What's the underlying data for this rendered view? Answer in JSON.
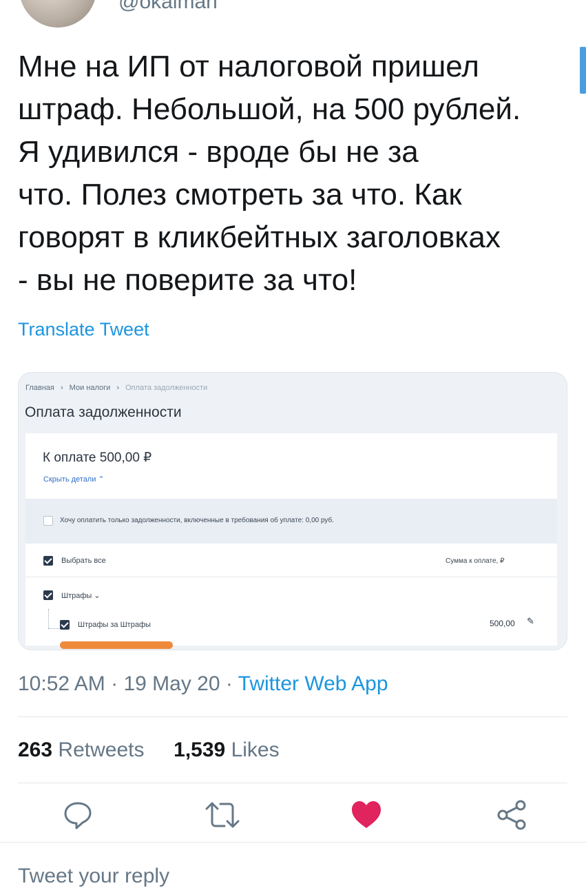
{
  "header": {
    "handle": "@okalman"
  },
  "tweet": {
    "text": "Мне на ИП от налоговой пришел\nштраф. Небольшой, на 500 рублей.\nЯ удивился - вроде бы не за\nчто. Полез смотреть за что. Как\nговорят в кликбейтных заголовках\n- вы не поверите за что!",
    "translate_label": "Translate Tweet"
  },
  "embedded": {
    "breadcrumbs": [
      "Главная",
      "Мои налоги",
      "Оплата задолженности"
    ],
    "title": "Оплата задолженности",
    "amount": "К оплате 500,00 ₽",
    "hide_details": "Скрыть детали ⌃",
    "only_debt_option": "Хочу оплатить только задолженности, включенные в требования об уплате: 0,00 руб.",
    "select_all": "Выбрать все",
    "sum_header": "Сумма к оплате, ₽",
    "group_label": "Штрафы ⌄",
    "item_label": "Штрафы за Штрафы",
    "item_amount": "500,00",
    "underline_color": "#ee8a3c"
  },
  "meta": {
    "time": "10:52 AM",
    "date": "19 May 20",
    "source": "Twitter Web App",
    "separator": " · "
  },
  "stats": {
    "retweets_count": "263",
    "retweets_label": "Retweets",
    "likes_count": "1,539",
    "likes_label": "Likes"
  },
  "actions": {
    "reply_icon": "reply-icon",
    "retweet_icon": "retweet-icon",
    "like_icon": "heart-icon",
    "share_icon": "share-icon",
    "like_color": "#e0245e",
    "icon_color": "#657786"
  },
  "reply": {
    "placeholder": "Tweet your reply"
  }
}
